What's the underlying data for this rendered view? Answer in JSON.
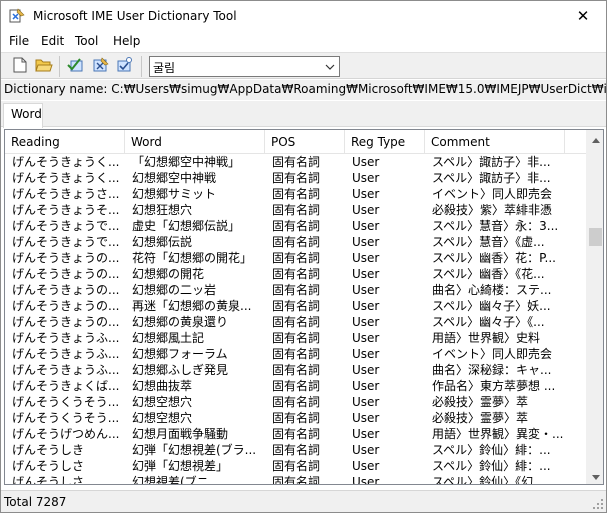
{
  "window": {
    "title": "Microsoft IME User Dictionary Tool",
    "close_glyph": "✕"
  },
  "menu": [
    "File",
    "Edit",
    "Tool",
    "Help"
  ],
  "toolbar": {
    "buttons": [
      {
        "name": "new-file-icon"
      },
      {
        "name": "open-folder-icon"
      },
      {
        "name": "check-icon"
      },
      {
        "name": "register-word-icon"
      },
      {
        "name": "edit-word-icon"
      }
    ],
    "font_combo": "굴림"
  },
  "dictionary": {
    "label": "Dictionary name:",
    "path": "C:₩Users₩simug₩AppData₩Roaming₩Microsoft₩IME₩15.0₩IMEJP₩UserDict₩imjp15cu.dic"
  },
  "tabs": [
    {
      "label": "Word"
    }
  ],
  "table": {
    "columns": [
      "Reading",
      "Word",
      "POS",
      "Reg Type",
      "Comment"
    ],
    "rows": [
      {
        "reading": "げんそうきょうく...",
        "word": "「幻想郷空中神戦」",
        "pos": "固有名詞",
        "reg": "User",
        "comment": "スペル〉諏訪子〉非..."
      },
      {
        "reading": "げんそうきょうく...",
        "word": "幻想郷空中神戦",
        "pos": "固有名詞",
        "reg": "User",
        "comment": "スペル〉諏訪子〉非..."
      },
      {
        "reading": "げんそうきょうさ...",
        "word": "幻想郷サミット",
        "pos": "固有名詞",
        "reg": "User",
        "comment": "イベント〉同人即売会"
      },
      {
        "reading": "げんそうきょうそ...",
        "word": "幻想狂想穴",
        "pos": "固有名詞",
        "reg": "User",
        "comment": "必殺技〉紫〉萃緋非憑"
      },
      {
        "reading": "げんそうきょうで...",
        "word": "虚史「幻想郷伝説」",
        "pos": "固有名詞",
        "reg": "User",
        "comment": "スペル〉慧音〉永：3..."
      },
      {
        "reading": "げんそうきょうで...",
        "word": "幻想郷伝説",
        "pos": "固有名詞",
        "reg": "User",
        "comment": "スペル〉慧音〉《虚..."
      },
      {
        "reading": "げんそうきょうの...",
        "word": "花符「幻想郷の開花」",
        "pos": "固有名詞",
        "reg": "User",
        "comment": "スペル〉幽香〉花：P..."
      },
      {
        "reading": "げんそうきょうの...",
        "word": "幻想郷の開花",
        "pos": "固有名詞",
        "reg": "User",
        "comment": "スペル〉幽香〉《花..."
      },
      {
        "reading": "げんそうきょうの...",
        "word": "幻想郷の二ッ岩",
        "pos": "固有名詞",
        "reg": "User",
        "comment": "曲名〉心綺楼：ステ..."
      },
      {
        "reading": "げんそうきょうの...",
        "word": "再迷「幻想郷の黄泉...",
        "pos": "固有名詞",
        "reg": "User",
        "comment": "スペル〉幽々子〉妖..."
      },
      {
        "reading": "げんそうきょうの...",
        "word": "幻想郷の黄泉還り",
        "pos": "固有名詞",
        "reg": "User",
        "comment": "スペル〉幽々子〉《..."
      },
      {
        "reading": "げんそうきょうふ...",
        "word": "幻想郷風土記",
        "pos": "固有名詞",
        "reg": "User",
        "comment": "用語〉世界観〉史料"
      },
      {
        "reading": "げんそうきょうふ...",
        "word": "幻想郷フォーラム",
        "pos": "固有名詞",
        "reg": "User",
        "comment": "イベント〉同人即売会"
      },
      {
        "reading": "げんそうきょうふ...",
        "word": "幻想郷ふしぎ発見",
        "pos": "固有名詞",
        "reg": "User",
        "comment": "曲名〉深秘録：キャ..."
      },
      {
        "reading": "げんそうきょくば...",
        "word": "幻想曲抜萃",
        "pos": "固有名詞",
        "reg": "User",
        "comment": "作品名〉東方萃夢想 ..."
      },
      {
        "reading": "げんそうくうそう...",
        "word": "幻想空想穴",
        "pos": "固有名詞",
        "reg": "User",
        "comment": "必殺技〉霊夢〉萃"
      },
      {
        "reading": "げんそうくうそう...",
        "word": "幻想空想穴",
        "pos": "固有名詞",
        "reg": "User",
        "comment": "必殺技〉霊夢〉萃"
      },
      {
        "reading": "げんそうげつめん...",
        "word": "幻想月面戦争騒動",
        "pos": "固有名詞",
        "reg": "User",
        "comment": "用語〉世界観〉異変・..."
      },
      {
        "reading": "げんそうしき",
        "word": "幻弾「幻想視差(ブラ...",
        "pos": "固有名詞",
        "reg": "User",
        "comment": "スペル〉鈴仙〉緋：..."
      },
      {
        "reading": "げんそうしさ",
        "word": "幻弾「幻想視差」",
        "pos": "固有名詞",
        "reg": "User",
        "comment": "スペル〉鈴仙〉緋：..."
      },
      {
        "reading": "げんそうしさ",
        "word": "幻想視差(ブニ...",
        "pos": "固有名詞",
        "reg": "User",
        "comment": "スペル〉鈴仙〉《幻..."
      }
    ]
  },
  "status": {
    "text": "Total 7287"
  },
  "scrollbar": {
    "up_glyph": "▲",
    "down_glyph": "▼"
  },
  "combo_arrow_glyph": "⌄"
}
